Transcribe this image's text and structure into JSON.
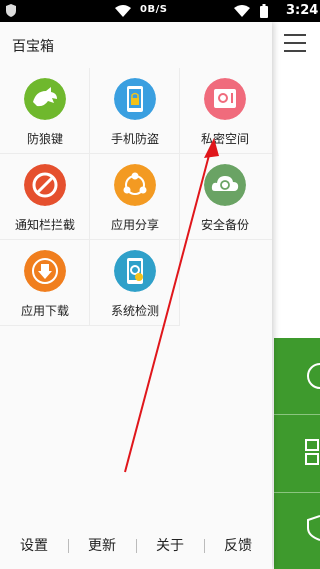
{
  "status_bar": {
    "net_speed": "0B/S",
    "time": "3:24"
  },
  "app": {
    "title": "百宝箱"
  },
  "tools": [
    {
      "label": "防狼键",
      "icon": "dragon-icon",
      "color": "#6fb82d"
    },
    {
      "label": "手机防盗",
      "icon": "phone-lock-icon",
      "color": "#3a9fe0"
    },
    {
      "label": "私密空间",
      "icon": "safe-icon",
      "color": "#f06b7c"
    },
    {
      "label": "通知栏拦截",
      "icon": "block-icon",
      "color": "#e5502e"
    },
    {
      "label": "应用分享",
      "icon": "share-icon",
      "color": "#f39a22"
    },
    {
      "label": "安全备份",
      "icon": "cloud-backup-icon",
      "color": "#6aa364"
    },
    {
      "label": "应用下载",
      "icon": "download-icon",
      "color": "#f07e1e"
    },
    {
      "label": "系统检测",
      "icon": "system-check-icon",
      "color": "#2fa0c9"
    }
  ],
  "bottom_bar": {
    "settings": "设置",
    "update": "更新",
    "about": "关于",
    "feedback": "反馈"
  },
  "colors": {
    "side_green": "#3e9a2d",
    "annotation_arrow": "#e0161b"
  }
}
